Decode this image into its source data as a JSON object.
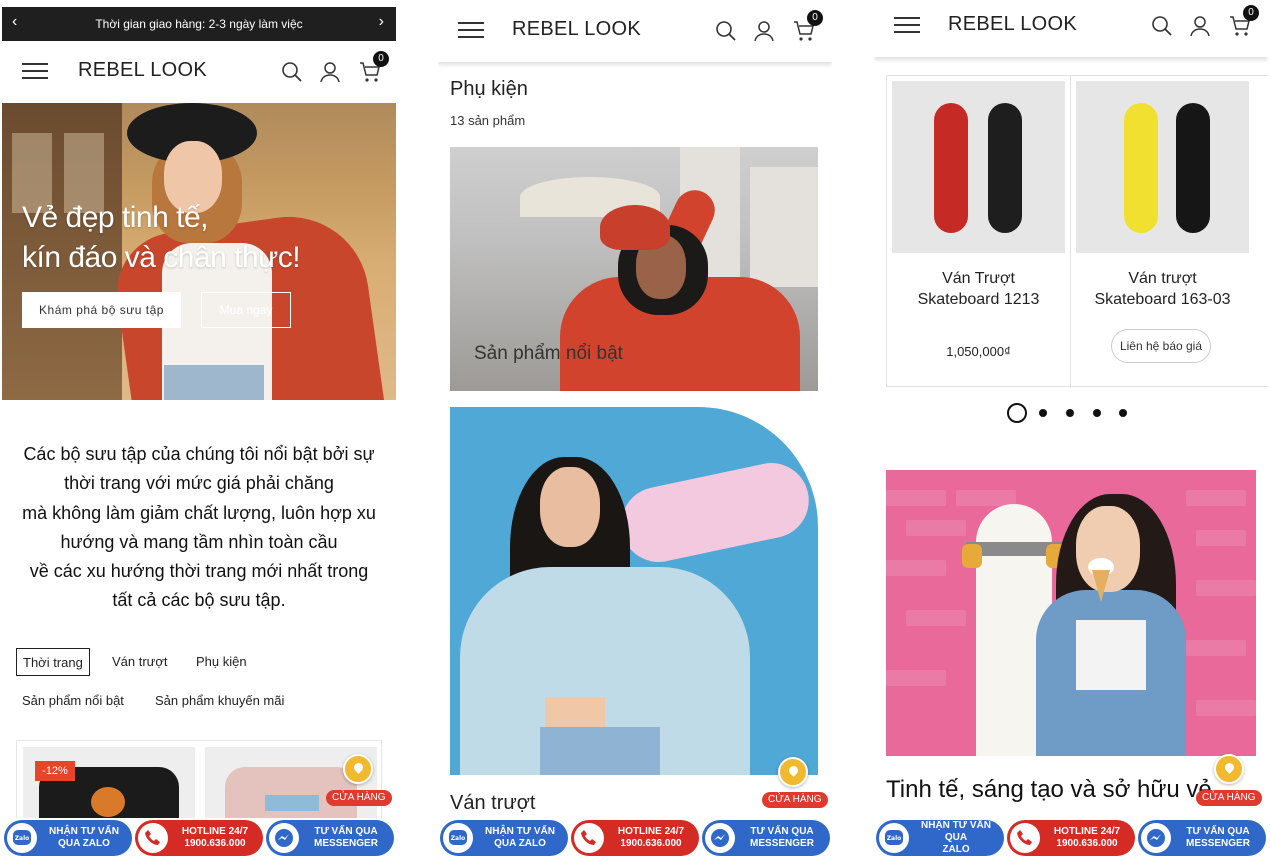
{
  "brand": "REBEL LOOK",
  "cart_count": "0",
  "colors": {
    "accent_red": "#d52b25",
    "accent_blue": "#2f68c8",
    "discount": "#e8442a",
    "store": "#f0b930"
  },
  "panel1": {
    "promo_text": "Thời gian giao hàng: 2-3 ngày làm việc",
    "hero_line1": "Vẻ đẹp tinh tế,",
    "hero_line2": "kín đáo và chân thực!",
    "btn_explore": "Khám phá bộ sưu tập",
    "btn_buy": "Mua ngay",
    "intro": [
      "Các bộ sưu tập của chúng tôi nổi bật bởi sự",
      "thời trang với mức giá phải chăng",
      "mà không làm giảm chất lượng, luôn hợp xu",
      "hướng và mang tầm nhìn toàn cầu",
      "về các xu hướng thời trang mới nhất trong",
      "tất cả các bộ sưu tập."
    ],
    "tabs": [
      "Thời trang",
      "Ván trượt",
      "Phụ kiện",
      "Sản phẩm nổi bật",
      "Sản phẩm khuyến mãi"
    ],
    "active_tab": "Thời trang",
    "discount": "-12%"
  },
  "panel2": {
    "category_title": "Phụ kiện",
    "category_count": "13 sản phẩm",
    "featured_caption": "Sản phẩm nổi bật",
    "second_category": "Ván trượt"
  },
  "panel3": {
    "products": [
      {
        "name_line1": "Ván Trượt",
        "name_line2": "Skateboard 1213",
        "price": "1,050,000₫"
      },
      {
        "name_line1": "Ván trượt",
        "name_line2": "Skateboard 163-03",
        "action": "Liên hệ báo giá"
      }
    ],
    "headline": "Tinh tế, sáng tạo và sở hữu vẻ"
  },
  "store_label": "CỬA HÀNG",
  "contact_bar": {
    "zalo_line1": "NHẬN TƯ VẤN",
    "zalo_line2": "QUA ZALO",
    "hotline_line1": "HOTLINE 24/7",
    "hotline_line2": "1900.636.000",
    "messenger_line1": "TƯ VẤN QUA",
    "messenger_line2": "MESSENGER"
  },
  "panel3_contact_bar": {
    "zalo_line1": "NHẬN TƯ VẤN QUA",
    "zalo_line2": "ZALO"
  },
  "icons": [
    "menu-icon",
    "search-icon",
    "user-icon",
    "cart-icon",
    "chevron-left-icon",
    "chevron-right-icon",
    "map-pin-icon",
    "zalo-icon",
    "phone-icon",
    "messenger-icon"
  ]
}
